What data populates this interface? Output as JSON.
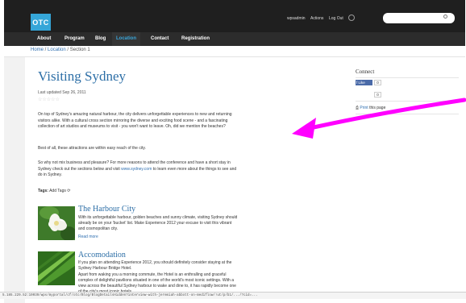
{
  "header": {
    "logo_text": "OTC",
    "user_nav": [
      "wpsadmin",
      "Actions",
      "Log Out"
    ],
    "search": {
      "placeholder": "",
      "value": ""
    }
  },
  "nav": {
    "items": [
      {
        "label": "About"
      },
      {
        "label": "Program"
      },
      {
        "label": "Blog"
      },
      {
        "label": "Location",
        "active": true
      },
      {
        "label": "Contact"
      },
      {
        "label": "Registration"
      }
    ]
  },
  "breadcrumb": {
    "home": "Home",
    "sep1": " / ",
    "loc": "Location",
    "sep2": " / ",
    "current": "Section 1"
  },
  "article": {
    "title": "Visiting Sydney",
    "updated": "Last updated Sep 26, 2011",
    "stars": "☆☆☆☆☆",
    "p1": "On top of Sydney's amazing natural harbour, the city delivers unforgettable experiences to new and returning visitors alike. With a cultural cross section mirroring the diverse and exciting food scene - and a fascinating collection of art studios and museums to visit - you won't want to leave. Oh, did we mention the beaches?",
    "p2": "Best of all, these attractions are within easy reach of the city.",
    "p3_a": "So why not mix business and pleasure? For more reasons to attend the conference and have a short stay in Sydney check out the sections below and visit ",
    "p3_link": "www.sydney.com",
    "p3_b": " to learn even more about the things to see and do in Sydney.",
    "tags_label": "Tags:",
    "tags_add": "Add Tags"
  },
  "stories": [
    {
      "title": "The Harbour City",
      "text": "With its unforgettable harbour, golden beaches and sunny climate, visiting Sydney should already be on your 'bucket' list. Make Experience 2012 your excuse to visit this vibrant and cosmopolitan city.",
      "read_more": "Read more"
    },
    {
      "title": "Accomodation",
      "text": "If you plan on attending Experience 2012, you should definitely consider staying at the Sydney Harbour Bridge Hotel.",
      "text2": "Apart from waking you a morning commute, the Hotel is an enthralling and graceful complex of delightful pavilions situated in one of the world's most iconic settings. With a view across the beautiful Sydney harbour to wake and dine to, it has rapidly become one of the city's most iconic hotels."
    }
  ],
  "sidebar": {
    "heading": "Connect",
    "like_label": "Like",
    "like_count": "0",
    "share_count": "0",
    "print_label": "Print",
    "print_rest": " this page"
  },
  "statusbar": {
    "url": "5.185.229.52:10039/wps/myportal/cf/otc/Blog/BlogDetailsHidden?interview-with-jeremiah-abbott-on-mediflow/!ut/p/b1/.../?cid=..."
  },
  "colors": {
    "accent_blue": "#35a6d8",
    "link_blue": "#2f6fb0",
    "title_blue": "#2c6ea6",
    "annotation_magenta": "#ff00ff"
  }
}
